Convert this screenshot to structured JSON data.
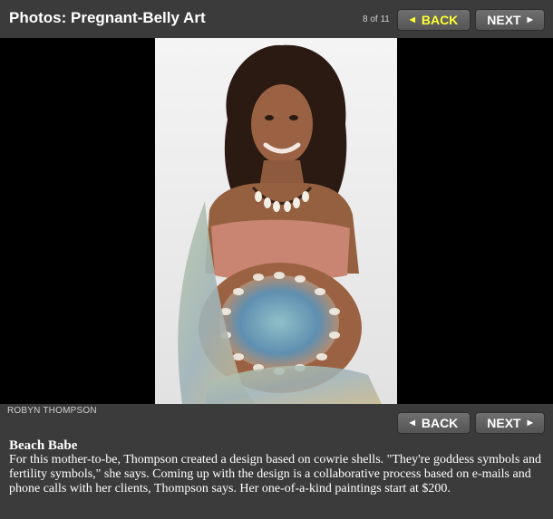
{
  "header": {
    "title": "Photos: Pregnant-Belly Art",
    "counter": "8 of 11",
    "back_label": "BACK",
    "next_label": "NEXT"
  },
  "photo": {
    "credit": "ROBYN THOMPSON"
  },
  "footer_nav": {
    "back_label": "BACK",
    "next_label": "NEXT"
  },
  "caption": {
    "title": "Beach Babe",
    "text": "For this mother-to-be, Thompson created a design based on cowrie shells. \"They're goddess symbols and fertility symbols,\" she says. Coming up with the design is a collaborative process based on e-mails and phone calls with her clients, Thompson says. Her one-of-a-kind paintings start at $200."
  },
  "colors": {
    "background": "#3b3b3b",
    "stage": "#000000",
    "active_button_text": "#ffff33"
  },
  "icons": [
    "left-arrow-icon",
    "right-arrow-icon"
  ]
}
